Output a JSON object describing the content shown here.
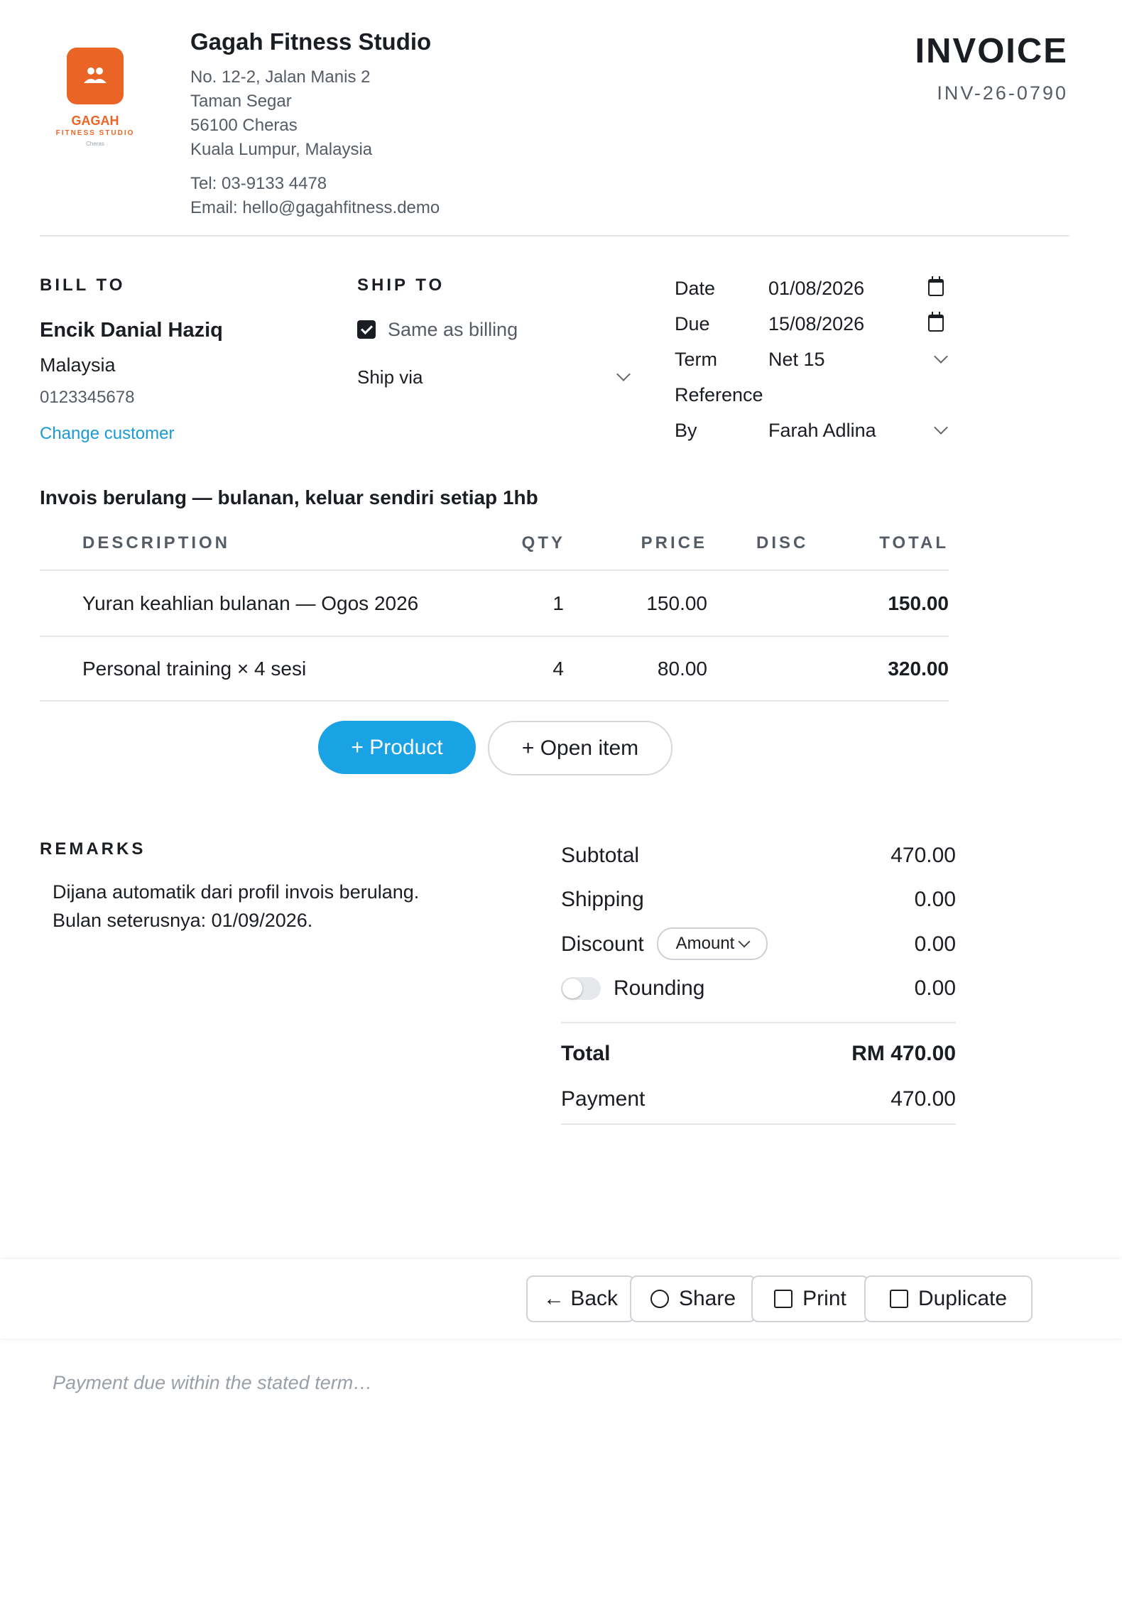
{
  "company": {
    "logo_text": "GAGAH",
    "logo_sub": "FITNESS STUDIO",
    "logo_loc": "Cheras",
    "name": "Gagah Fitness Studio",
    "address": [
      "No. 12-2, Jalan Manis 2",
      "Taman Segar",
      "56100 Cheras",
      "Kuala Lumpur, Malaysia"
    ],
    "tel": "Tel: 03-9133 4478",
    "email": "Email: hello@gagahfitness.demo"
  },
  "invoice": {
    "title": "INVOICE",
    "number": "INV-26-0790"
  },
  "bill_to": {
    "heading": "BILL TO",
    "name": "Encik Danial Haziq",
    "country": "Malaysia",
    "phone": "0123345678",
    "change_link": "Change customer"
  },
  "ship_to": {
    "heading": "SHIP TO",
    "same_as_billing": "Same as billing",
    "ship_via": "Ship via"
  },
  "meta": {
    "date_label": "Date",
    "date_value": "01/08/2026",
    "due_label": "Due",
    "due_value": "15/08/2026",
    "term_label": "Term",
    "term_value": "Net 15",
    "reference_label": "Reference",
    "by_label": "By",
    "by_value": "Farah Adlina"
  },
  "recurring_note": "Invois berulang — bulanan, keluar sendiri setiap 1hb",
  "table": {
    "headers": {
      "description": "DESCRIPTION",
      "qty": "QTY",
      "price": "PRICE",
      "disc": "DISC",
      "total": "TOTAL"
    },
    "rows": [
      {
        "description": "Yuran keahlian bulanan — Ogos 2026",
        "qty": "1",
        "price": "150.00",
        "disc": "",
        "total": "150.00"
      },
      {
        "description": "Personal training × 4 sesi",
        "qty": "4",
        "price": "80.00",
        "disc": "",
        "total": "320.00"
      }
    ]
  },
  "buttons": {
    "add_product": "+ Product",
    "add_open_item": "+ Open item"
  },
  "remarks": {
    "heading": "REMARKS",
    "line1": "Dijana automatik dari profil invois berulang.",
    "line2": "Bulan seterusnya: 01/09/2026."
  },
  "summary": {
    "subtotal_label": "Subtotal",
    "subtotal": "470.00",
    "shipping_label": "Shipping",
    "shipping": "0.00",
    "discount_label": "Discount",
    "discount_mode": "Amount",
    "discount": "0.00",
    "rounding_label": "Rounding",
    "rounding": "0.00",
    "rounding_enabled": false,
    "total_label": "Total",
    "total": "RM 470.00",
    "payment_label": "Payment",
    "payment": "470.00"
  },
  "actions": {
    "back": "← Back",
    "share": "Share",
    "print": "Print",
    "duplicate": "Duplicate"
  },
  "footer_placeholder": "Payment due within the stated term…",
  "colors": {
    "brand": "#ea6425",
    "accent": "#19a2e4",
    "link": "#1a9ad6"
  }
}
